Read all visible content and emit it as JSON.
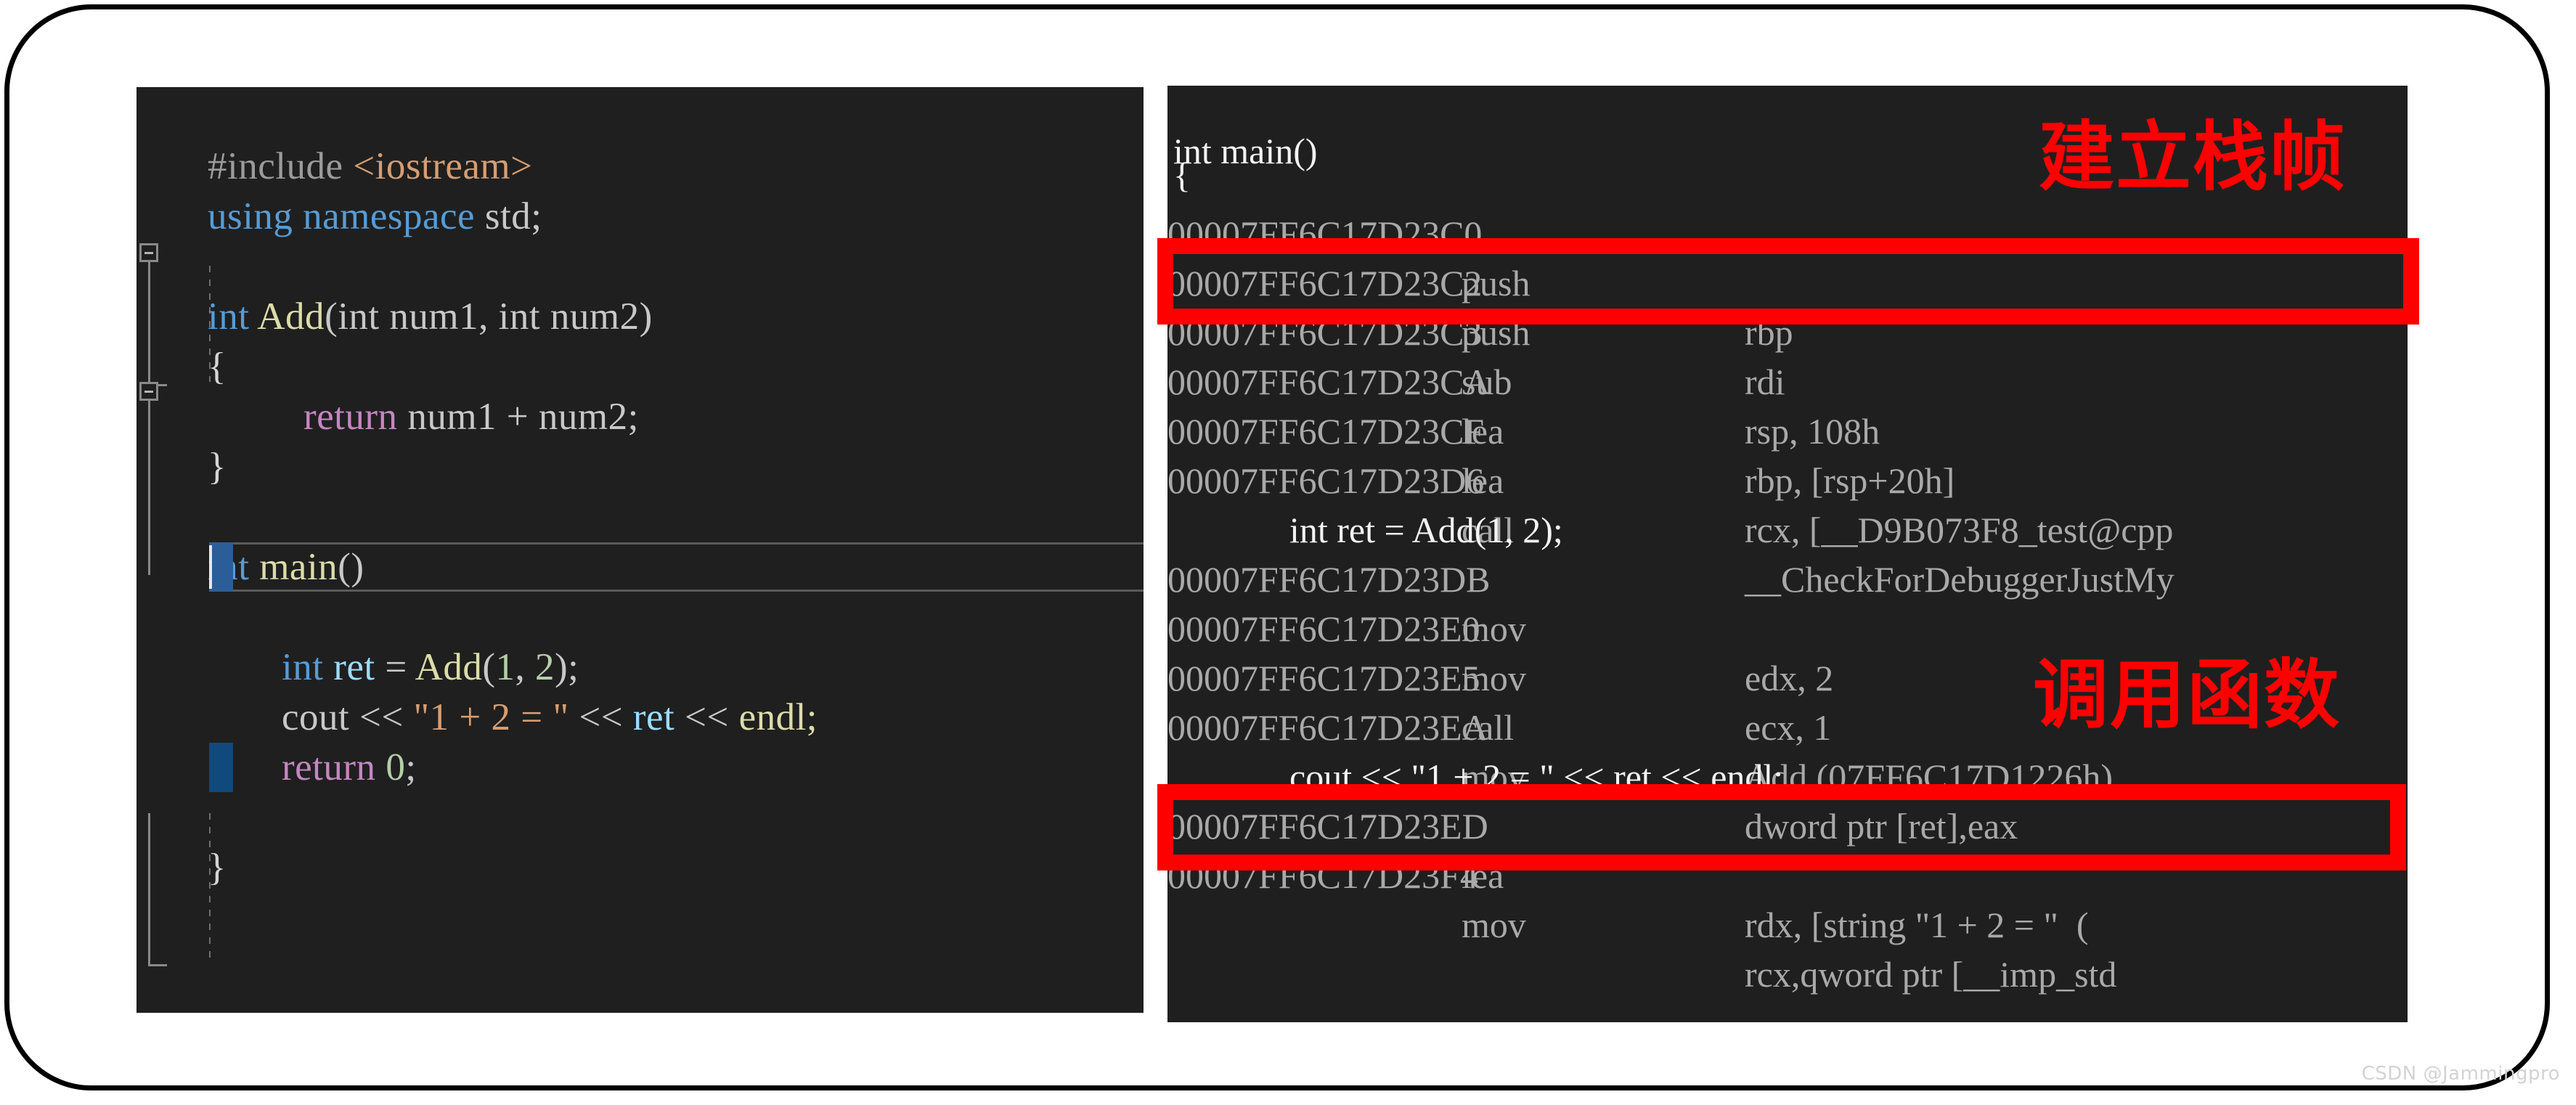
{
  "source_editor": {
    "name": "cpp-source-editor",
    "background_color": "#1f1f1f",
    "lines": [
      {
        "id": "l1",
        "text": "#include <iostream>"
      },
      {
        "id": "l2",
        "text": "using namespace std;"
      },
      {
        "id": "l3",
        "text": ""
      },
      {
        "id": "l4",
        "text": "int Add(int num1, int num2)"
      },
      {
        "id": "l5",
        "text": "{"
      },
      {
        "id": "l6",
        "text": "    return num1 + num2;"
      },
      {
        "id": "l7",
        "text": "}"
      },
      {
        "id": "l8",
        "text": ""
      },
      {
        "id": "l9",
        "text": "int main()"
      },
      {
        "id": "l10",
        "text": "{"
      },
      {
        "id": "l11",
        "text": "    int ret = Add(1, 2);"
      },
      {
        "id": "l12",
        "text": "    cout << \"1 + 2 = \" << ret << endl;"
      },
      {
        "id": "l13",
        "text": "    return 0;"
      },
      {
        "id": "l14",
        "text": "}"
      }
    ],
    "tokens": {
      "include_directive": "#include",
      "include_header": " <iostream>",
      "using_kw": "using",
      "namespace_kw": " namespace",
      "std_name": " std;",
      "int_kw": "int",
      "add_fn": " Add",
      "add_params": "(int num1, int num2)",
      "open_brace": "{",
      "return_kw": "return",
      "return_expr": " num1 + num2;",
      "close_brace": "}",
      "main_fn": " main",
      "main_parens": "()",
      "int_ret_kw": "int",
      "ret_var": " ret",
      "eq_sign": " = ",
      "add_call": "Add",
      "add_args_open": "(",
      "arg_one": "1",
      "arg_comma": ", ",
      "arg_two": "2",
      "add_args_close": ");",
      "cout_name": "cout",
      "shift1": " << ",
      "cout_string": "\"1 + 2 = \"",
      "shift2": " << ",
      "ret_read": "ret",
      "shift3": " << ",
      "endl_name": "endl;",
      "return_zero_kw": "return",
      "zero_lit": " 0",
      "semicolon": ";"
    }
  },
  "disassembly": {
    "name": "disassembly-view",
    "background_color": "#1f1f1f",
    "rows": [
      {
        "kind": "source",
        "source": "int main()"
      },
      {
        "kind": "source",
        "source": "{"
      },
      {
        "kind": "asm",
        "address": "00007FF6C17D23C0",
        "mnemonic": "push",
        "operands": "rbp"
      },
      {
        "kind": "asm",
        "address": "00007FF6C17D23C2",
        "mnemonic": "push",
        "operands": "rdi"
      },
      {
        "kind": "asm",
        "address": "00007FF6C17D23C3",
        "mnemonic": "sub",
        "operands": "rsp, 108h"
      },
      {
        "kind": "asm",
        "address": "00007FF6C17D23CA",
        "mnemonic": "lea",
        "operands": "rbp, [rsp+20h]"
      },
      {
        "kind": "asm",
        "address": "00007FF6C17D23CF",
        "mnemonic": "lea",
        "operands": "rcx, [__D9B073F8_test@cpp"
      },
      {
        "kind": "asm",
        "address": "00007FF6C17D23D6",
        "mnemonic": "call",
        "operands": "__CheckForDebuggerJustMy"
      },
      {
        "kind": "source",
        "source": "    int ret = Add(1, 2);"
      },
      {
        "kind": "asm",
        "address": "00007FF6C17D23DB",
        "mnemonic": "mov",
        "operands": "edx, 2"
      },
      {
        "kind": "asm",
        "address": "00007FF6C17D23E0",
        "mnemonic": "mov",
        "operands": "ecx, 1"
      },
      {
        "kind": "asm",
        "address": "00007FF6C17D23E5",
        "mnemonic": "call",
        "operands": "Add (07FF6C17D1226h)"
      },
      {
        "kind": "asm",
        "address": "00007FF6C17D23EA",
        "mnemonic": "mov",
        "operands": "dword ptr [ret],eax"
      },
      {
        "kind": "source",
        "source": "    cout << \"1 + 2 = \" << ret << endl;"
      },
      {
        "kind": "asm",
        "address": "00007FF6C17D23ED",
        "mnemonic": "lea",
        "operands": "rdx, [string \"1 + 2 = \"  ("
      },
      {
        "kind": "asm",
        "address": "00007FF6C17D23F4",
        "mnemonic": "mov",
        "operands": "rcx,qword ptr [__imp_std"
      }
    ]
  },
  "annotations": {
    "color": "#fe0000",
    "labels": [
      {
        "id": "establish-stack-frame",
        "text": "建立栈帧"
      },
      {
        "id": "call-function",
        "text": "调用函数"
      }
    ],
    "boxes": [
      {
        "id": "stack-frame-box",
        "target": "push rbp / push rdi"
      },
      {
        "id": "call-add-box",
        "target": "call Add (07FF6C17D1226h)"
      }
    ]
  },
  "watermark": {
    "text": "CSDN @Jammingpro"
  }
}
